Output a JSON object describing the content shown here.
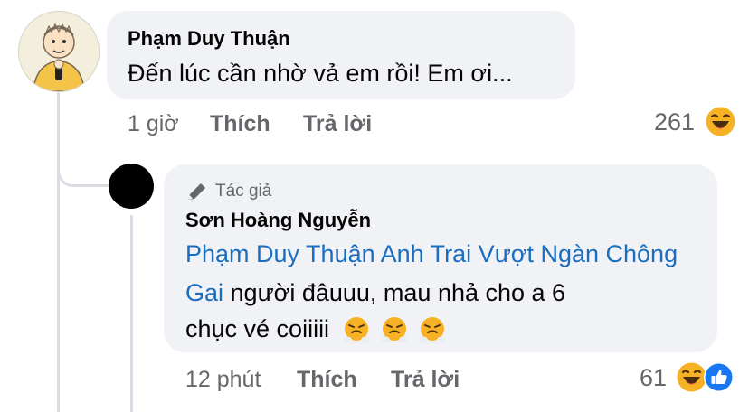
{
  "comment": {
    "author": "Phạm Duy Thuận",
    "text": "Đến lúc cần nhờ vả em rồi! Em ơi...",
    "time": "1 giờ",
    "like_label": "Thích",
    "reply_label": "Trả lời",
    "reaction_count": "261",
    "reaction_icon": "laughing-emoji-icon"
  },
  "reply": {
    "badge": "Tác giả",
    "badge_icon": "pencil-icon",
    "author": "Sơn Hoàng Nguyễn",
    "mention": "Phạm Duy Thuận Anh Trai Vượt Ngàn Chông Gai",
    "text_part1": " người đâuuu, mau nhả cho a 6",
    "text_part2": "chục vé coiiiii",
    "emojis": [
      "steam-nose-emoji-icon",
      "steam-nose-emoji-icon",
      "steam-nose-emoji-icon"
    ],
    "time": "12 phút",
    "like_label": "Thích",
    "reply_label": "Trả lời",
    "reaction_count": "61",
    "reaction_icons": [
      "laughing-emoji-icon",
      "like-thumb-icon"
    ]
  },
  "colors": {
    "bubble": "#f0f2f5",
    "mention": "#1a6dbf",
    "meta": "#65676b",
    "like": "#1877f2"
  }
}
